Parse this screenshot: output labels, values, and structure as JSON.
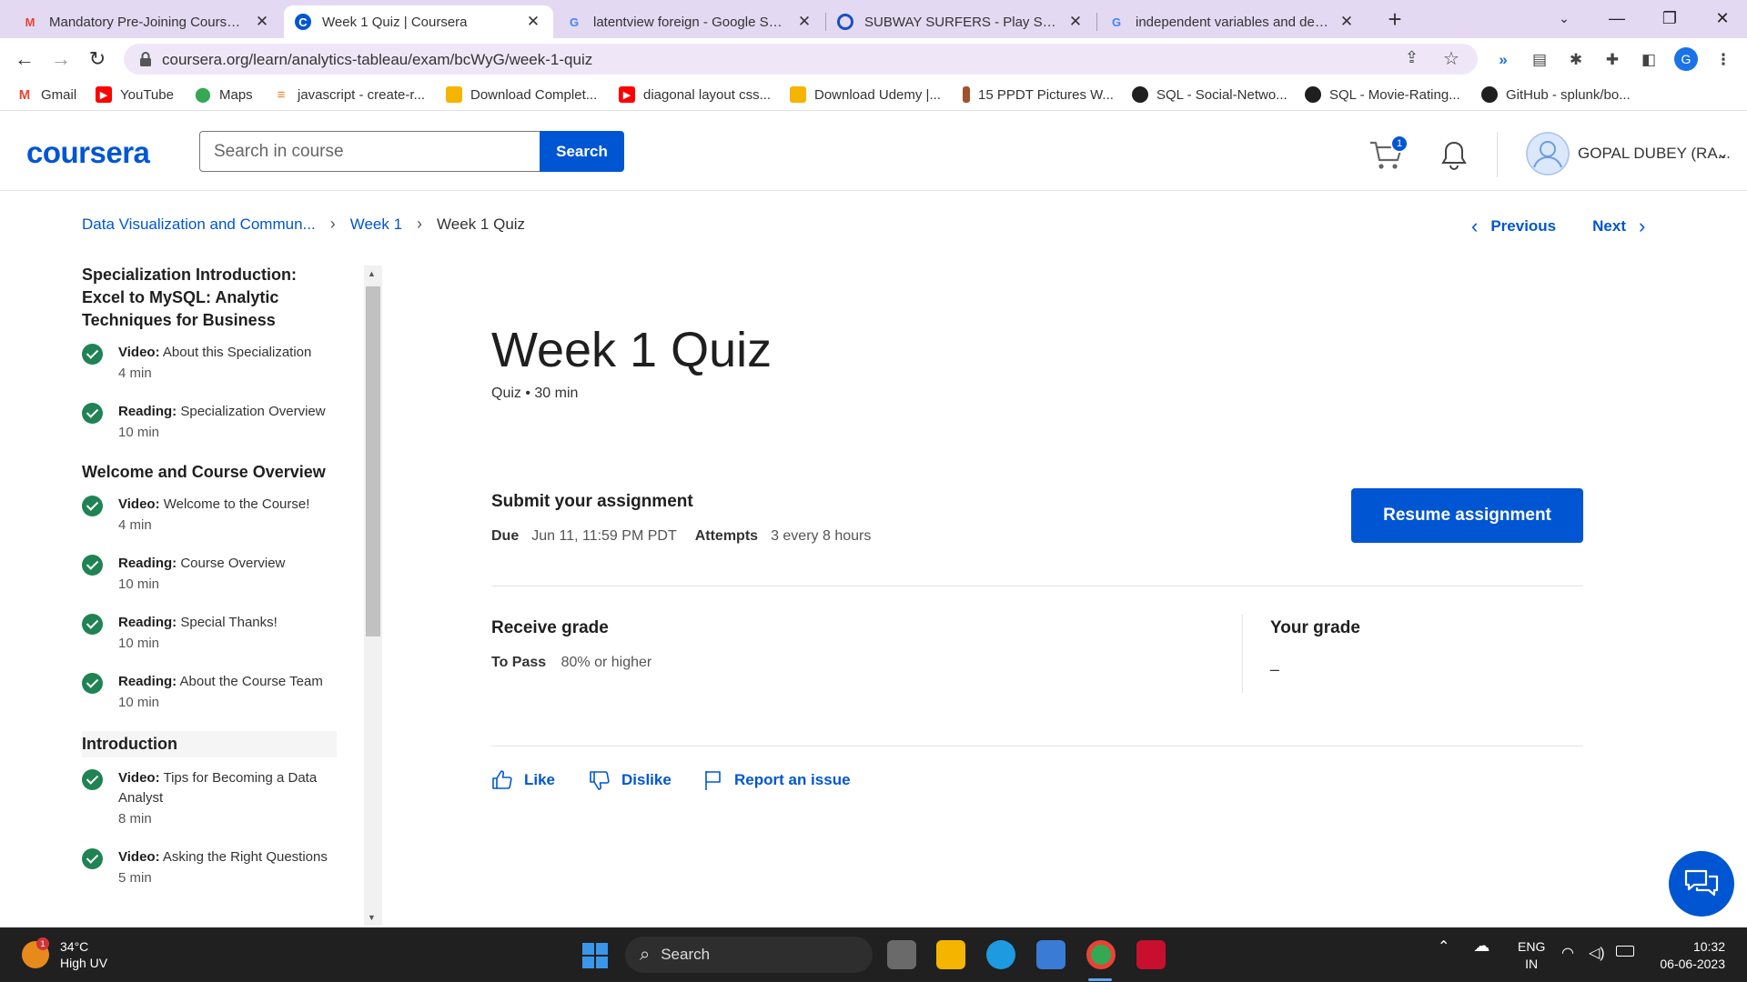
{
  "browser": {
    "tabs": [
      {
        "title": "Mandatory Pre-Joining Courses U",
        "favicon": "gmail-icon",
        "active": false
      },
      {
        "title": "Week 1 Quiz | Coursera",
        "favicon": "coursera-icon",
        "active": true
      },
      {
        "title": "latentview foreign - Google Sear",
        "favicon": "google-icon",
        "active": false
      },
      {
        "title": "SUBWAY SURFERS - Play Subway",
        "favicon": "subway-icon",
        "active": false
      },
      {
        "title": "independent variables and deper",
        "favicon": "google-icon",
        "active": false
      }
    ],
    "url": "coursera.org/learn/analytics-tableau/exam/bcWyG/week-1-quiz",
    "profile_initial": "G",
    "bookmarks": [
      {
        "label": "Gmail",
        "icon": "gmail-icon",
        "color": "#ea4335"
      },
      {
        "label": "YouTube",
        "icon": "youtube-icon",
        "color": "#ff0000"
      },
      {
        "label": "Maps",
        "icon": "maps-icon",
        "color": "#34a853"
      },
      {
        "label": "javascript - create-r...",
        "icon": "stackoverflow-icon",
        "color": "#f48024"
      },
      {
        "label": "Download Complet...",
        "icon": "folder-icon",
        "color": "#f5b400"
      },
      {
        "label": "diagonal layout css...",
        "icon": "youtube-icon",
        "color": "#ff0000"
      },
      {
        "label": "Download Udemy |...",
        "icon": "folder-icon",
        "color": "#f5b400"
      },
      {
        "label": "15 PPDT Pictures W...",
        "icon": "bookmark-icon",
        "color": "#a0522d"
      },
      {
        "label": "SQL - Social-Netwo...",
        "icon": "github-icon",
        "color": "#1f1f1f"
      },
      {
        "label": "SQL - Movie-Rating...",
        "icon": "github-icon",
        "color": "#1f1f1f"
      },
      {
        "label": "GitHub - splunk/bo...",
        "icon": "github-icon",
        "color": "#1f1f1f"
      }
    ]
  },
  "header": {
    "logo": "coursera",
    "search_placeholder": "Search in course",
    "search_button": "Search",
    "cart_count": "1",
    "username": "GOPAL DUBEY (RA..."
  },
  "breadcrumb": {
    "course": "Data Visualization and Commun...",
    "week": "Week 1",
    "current": "Week 1 Quiz"
  },
  "nav": {
    "previous": "Previous",
    "next": "Next"
  },
  "sidebar": {
    "sections": [
      {
        "title": "Specialization Introduction: Excel to MySQL: Analytic Techniques for Business",
        "items": [
          {
            "type": "Video:",
            "name": "About this Specialization",
            "duration": "4 min"
          },
          {
            "type": "Reading:",
            "name": "Specialization Overview",
            "duration": "10 min"
          }
        ]
      },
      {
        "title": "Welcome and Course Overview",
        "items": [
          {
            "type": "Video:",
            "name": "Welcome to the Course!",
            "duration": "4 min"
          },
          {
            "type": "Reading:",
            "name": "Course Overview",
            "duration": "10 min"
          },
          {
            "type": "Reading:",
            "name": "Special Thanks!",
            "duration": "10 min"
          },
          {
            "type": "Reading:",
            "name": "About the Course Team",
            "duration": "10 min"
          }
        ]
      },
      {
        "title": "Introduction",
        "items": [
          {
            "type": "Video:",
            "name": "Tips for Becoming a Data Analyst",
            "duration": "8 min"
          },
          {
            "type": "Video:",
            "name": "Asking the Right Questions",
            "duration": "5 min"
          }
        ]
      }
    ]
  },
  "quiz": {
    "title": "Week 1 Quiz",
    "meta": "Quiz • 30 min",
    "submit_heading": "Submit your assignment",
    "due_label": "Due",
    "due_value": "Jun 11, 11:59 PM PDT",
    "attempts_label": "Attempts",
    "attempts_value": "3 every 8 hours",
    "resume_button": "Resume assignment",
    "receive_grade_heading": "Receive grade",
    "to_pass_label": "To Pass",
    "to_pass_value": "80% or higher",
    "your_grade_heading": "Your grade",
    "your_grade_value": "–"
  },
  "feedback": {
    "like": "Like",
    "dislike": "Dislike",
    "report": "Report an issue"
  },
  "taskbar": {
    "temperature": "34°C",
    "weather_desc": "High UV",
    "weather_badge": "1",
    "search_label": "Search",
    "lang_line1": "ENG",
    "lang_line2": "IN",
    "time": "10:32",
    "date": "06-06-2023"
  },
  "colors": {
    "brand": "#0056d2",
    "complete": "#1f8354"
  }
}
